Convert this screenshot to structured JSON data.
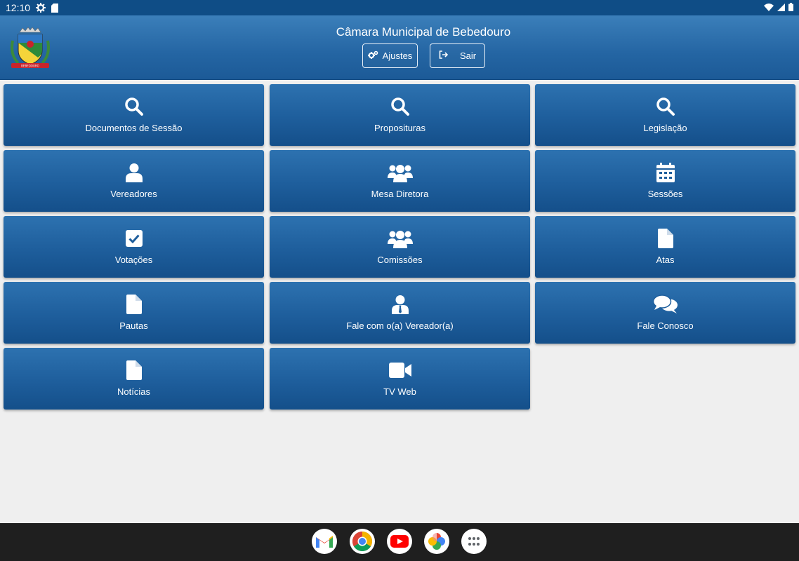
{
  "status_bar": {
    "time": "12:10"
  },
  "header": {
    "title": "Câmara Municipal de Bebedouro",
    "ajustes_label": "Ajustes",
    "sair_label": "Sair"
  },
  "tiles": [
    {
      "label": "Documentos de Sessão",
      "icon": "search-icon"
    },
    {
      "label": "Proposituras",
      "icon": "search-icon"
    },
    {
      "label": "Legislação",
      "icon": "search-icon"
    },
    {
      "label": "Vereadores",
      "icon": "user-icon"
    },
    {
      "label": "Mesa Diretora",
      "icon": "users-icon"
    },
    {
      "label": "Sessões",
      "icon": "calendar-icon"
    },
    {
      "label": "Votações",
      "icon": "checkbox-icon"
    },
    {
      "label": "Comissões",
      "icon": "users-icon"
    },
    {
      "label": "Atas",
      "icon": "file-icon"
    },
    {
      "label": "Pautas",
      "icon": "file-icon"
    },
    {
      "label": "Fale com o(a) Vereador(a)",
      "icon": "user-tie-icon"
    },
    {
      "label": "Fale Conosco",
      "icon": "comments-icon"
    },
    {
      "label": "Notícias",
      "icon": "file-icon"
    },
    {
      "label": "TV Web",
      "icon": "video-icon"
    }
  ],
  "dock": [
    "gmail-icon",
    "chrome-icon",
    "youtube-icon",
    "photos-icon",
    "apps-icon"
  ]
}
